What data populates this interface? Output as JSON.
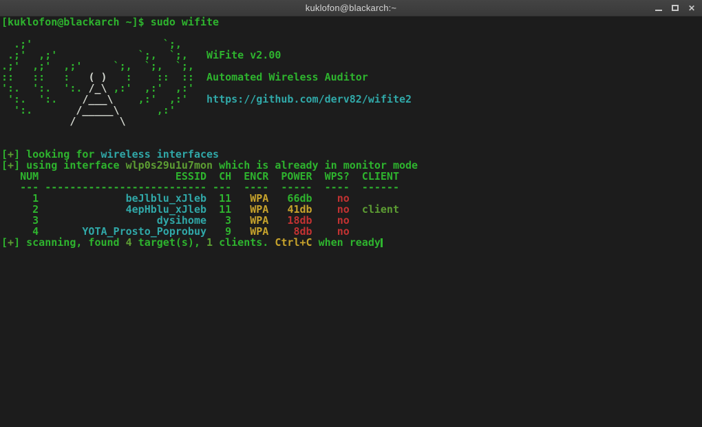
{
  "window": {
    "title": "kuklofon@blackarch:~",
    "close_glyph": "✕"
  },
  "palette": {
    "background": "#1c1c1c",
    "titlebar": "#3d3d3d",
    "title_text": "#d6d6d6",
    "green": "#2eb42e",
    "ansi_green": "#5d9e33",
    "cyan": "#30a8a8",
    "yellow": "#c7a32c",
    "red": "#c33232",
    "white": "#d3d7cf"
  },
  "app": {
    "name": "WiFite",
    "version": "v2.00",
    "subtitle": "Automated Wireless Auditor",
    "url": "https://github.com/derv82/wifite2"
  },
  "prompt": {
    "command_line": "[kuklofon@blackarch ~]$ sudo wifite"
  },
  "scan_results": {
    "columns": [
      "NUM",
      "ESSID",
      "CH",
      "ENCR",
      "POWER",
      "WPS?",
      "CLIENT"
    ],
    "rows": [
      {
        "num": "1",
        "essid": "beJlblu_xJleb",
        "ch": "11",
        "encr": "WPA",
        "power": "66db",
        "wps": "no",
        "client": ""
      },
      {
        "num": "2",
        "essid": "4epHblu_xJleb",
        "ch": "11",
        "encr": "WPA",
        "power": "41db",
        "wps": "no",
        "client": "client"
      },
      {
        "num": "3",
        "essid": "dysihome",
        "ch": "3",
        "encr": "WPA",
        "power": "18db",
        "wps": "no",
        "client": ""
      },
      {
        "num": "4",
        "essid": "YOTA_Prosto_Poprobuy",
        "ch": "9",
        "encr": "WPA",
        "power": "8db",
        "wps": "no",
        "client": ""
      }
    ],
    "status_interface": "wlp0s29u1u7mon",
    "status_targets_found": "4",
    "status_clients_found": "1"
  },
  "terminal": {
    "lines": [
      {
        "segments": [
          {
            "t": "[kuklofon@blackarch ~]$ sudo wifite",
            "c": "g"
          }
        ]
      },
      {
        "segments": []
      },
      {
        "segments": [
          {
            "t": "  .;'                     `;,",
            "c": "g"
          }
        ]
      },
      {
        "segments": [
          {
            "t": " .;'  ,;'             `;,  `;,   ",
            "c": "g"
          },
          {
            "t": "WiFite v2.00",
            "c": "g"
          }
        ]
      },
      {
        "segments": [
          {
            "t": ".;'  ,;'  ,;'     `;,  `;,  `;,",
            "c": "g"
          }
        ]
      },
      {
        "segments": [
          {
            "t": "::   ::   :   ",
            "c": "g"
          },
          {
            "t": "( )",
            "c": "w"
          },
          {
            "t": "   :    ::  ::  ",
            "c": "g"
          },
          {
            "t": "Automated Wireless Auditor",
            "c": "g"
          }
        ]
      },
      {
        "segments": [
          {
            "t": "':.  ':.  ':. ",
            "c": "g"
          },
          {
            "t": "/_\\",
            "c": "w"
          },
          {
            "t": " ,:'  ,:'  ,:'",
            "c": "g"
          }
        ]
      },
      {
        "segments": [
          {
            "t": " ':.  ':.    ",
            "c": "g"
          },
          {
            "t": "/___\\",
            "c": "w"
          },
          {
            "t": "    ,:'  ,:'   ",
            "c": "g"
          },
          {
            "t": "https://github.com/derv82/wifite2",
            "c": "c"
          }
        ]
      },
      {
        "segments": [
          {
            "t": "  ':.       ",
            "c": "g"
          },
          {
            "t": "/_____\\",
            "c": "w"
          },
          {
            "t": "      ,:'",
            "c": "g"
          }
        ]
      },
      {
        "segments": [
          {
            "t": "           ",
            "c": "g"
          },
          {
            "t": "/       \\",
            "c": "w"
          }
        ]
      },
      {
        "segments": []
      },
      {
        "segments": []
      },
      {
        "segments": [
          {
            "t": "[",
            "c": "g"
          },
          {
            "t": "+",
            "c": "ag"
          },
          {
            "t": "] looking for ",
            "c": "g"
          },
          {
            "t": "wireless interfaces",
            "c": "c"
          }
        ]
      },
      {
        "segments": [
          {
            "t": "[",
            "c": "g"
          },
          {
            "t": "+",
            "c": "ag"
          },
          {
            "t": "] using interface ",
            "c": "g"
          },
          {
            "t": "wlp0s29u1u7mon",
            "c": "ag"
          },
          {
            "t": " which is already in monitor mode",
            "c": "g"
          }
        ]
      },
      {
        "segments": [
          {
            "t": "   NUM                      ESSID  CH  ENCR  POWER  WPS?  CLIENT",
            "c": "g"
          }
        ]
      },
      {
        "segments": [
          {
            "t": "   --- -------------------------- ---  ----  -----  ----  ------",
            "c": "g"
          }
        ]
      },
      {
        "segments": [
          {
            "t": "     1              ",
            "c": "g"
          },
          {
            "t": "beJlblu_xJleb",
            "c": "c"
          },
          {
            "t": "  11   ",
            "c": "g"
          },
          {
            "t": "WPA",
            "c": "y"
          },
          {
            "t": "   66db    ",
            "c": "g"
          },
          {
            "t": "no",
            "c": "r"
          }
        ]
      },
      {
        "segments": [
          {
            "t": "     2              ",
            "c": "g"
          },
          {
            "t": "4epHblu_xJleb",
            "c": "c"
          },
          {
            "t": "  11   ",
            "c": "g"
          },
          {
            "t": "WPA",
            "c": "y"
          },
          {
            "t": "   ",
            "c": "g"
          },
          {
            "t": "41db",
            "c": "y"
          },
          {
            "t": "    ",
            "c": "g"
          },
          {
            "t": "no",
            "c": "r"
          },
          {
            "t": "  ",
            "c": "g"
          },
          {
            "t": "client",
            "c": "ag"
          }
        ]
      },
      {
        "segments": [
          {
            "t": "     3                   ",
            "c": "g"
          },
          {
            "t": "dysihome",
            "c": "c"
          },
          {
            "t": "   3   ",
            "c": "g"
          },
          {
            "t": "WPA",
            "c": "y"
          },
          {
            "t": "   18db",
            "c": "r"
          },
          {
            "t": "    ",
            "c": "g"
          },
          {
            "t": "no",
            "c": "r"
          }
        ]
      },
      {
        "segments": [
          {
            "t": "     4       ",
            "c": "g"
          },
          {
            "t": "YOTA_Prosto_Poprobuy",
            "c": "c"
          },
          {
            "t": "   9   ",
            "c": "g"
          },
          {
            "t": "WPA",
            "c": "y"
          },
          {
            "t": "    8db",
            "c": "r"
          },
          {
            "t": "    ",
            "c": "g"
          },
          {
            "t": "no",
            "c": "r"
          }
        ]
      },
      {
        "segments": [
          {
            "t": "[",
            "c": "g"
          },
          {
            "t": "+",
            "c": "ag"
          },
          {
            "t": "] scanning, found ",
            "c": "g"
          },
          {
            "t": "4",
            "c": "ag"
          },
          {
            "t": " target(s), ",
            "c": "g"
          },
          {
            "t": "1",
            "c": "ag"
          },
          {
            "t": " clients. ",
            "c": "g"
          },
          {
            "t": "Ctrl+C",
            "c": "y"
          },
          {
            "t": " when ready",
            "c": "g"
          }
        ],
        "cursor": true
      }
    ]
  }
}
